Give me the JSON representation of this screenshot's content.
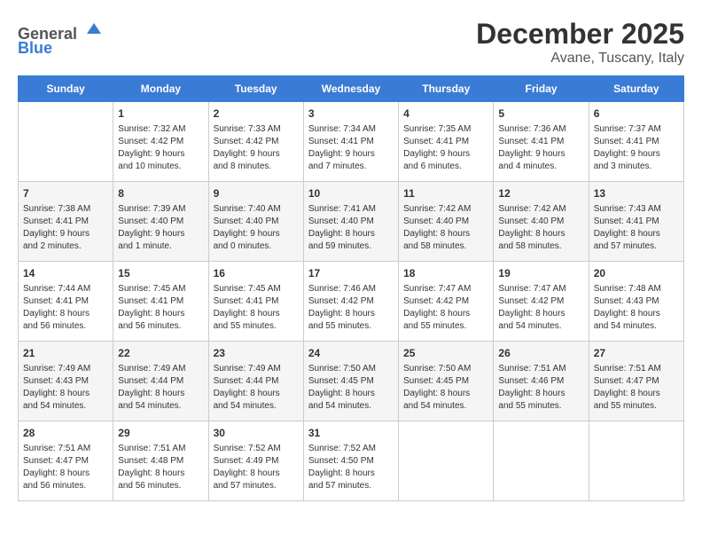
{
  "header": {
    "logo_line1": "General",
    "logo_line2": "Blue",
    "month": "December 2025",
    "location": "Avane, Tuscany, Italy"
  },
  "days_of_week": [
    "Sunday",
    "Monday",
    "Tuesday",
    "Wednesday",
    "Thursday",
    "Friday",
    "Saturday"
  ],
  "weeks": [
    [
      {
        "day": "",
        "content": ""
      },
      {
        "day": "1",
        "content": "Sunrise: 7:32 AM\nSunset: 4:42 PM\nDaylight: 9 hours\nand 10 minutes."
      },
      {
        "day": "2",
        "content": "Sunrise: 7:33 AM\nSunset: 4:42 PM\nDaylight: 9 hours\nand 8 minutes."
      },
      {
        "day": "3",
        "content": "Sunrise: 7:34 AM\nSunset: 4:41 PM\nDaylight: 9 hours\nand 7 minutes."
      },
      {
        "day": "4",
        "content": "Sunrise: 7:35 AM\nSunset: 4:41 PM\nDaylight: 9 hours\nand 6 minutes."
      },
      {
        "day": "5",
        "content": "Sunrise: 7:36 AM\nSunset: 4:41 PM\nDaylight: 9 hours\nand 4 minutes."
      },
      {
        "day": "6",
        "content": "Sunrise: 7:37 AM\nSunset: 4:41 PM\nDaylight: 9 hours\nand 3 minutes."
      }
    ],
    [
      {
        "day": "7",
        "content": "Sunrise: 7:38 AM\nSunset: 4:41 PM\nDaylight: 9 hours\nand 2 minutes."
      },
      {
        "day": "8",
        "content": "Sunrise: 7:39 AM\nSunset: 4:40 PM\nDaylight: 9 hours\nand 1 minute."
      },
      {
        "day": "9",
        "content": "Sunrise: 7:40 AM\nSunset: 4:40 PM\nDaylight: 9 hours\nand 0 minutes."
      },
      {
        "day": "10",
        "content": "Sunrise: 7:41 AM\nSunset: 4:40 PM\nDaylight: 8 hours\nand 59 minutes."
      },
      {
        "day": "11",
        "content": "Sunrise: 7:42 AM\nSunset: 4:40 PM\nDaylight: 8 hours\nand 58 minutes."
      },
      {
        "day": "12",
        "content": "Sunrise: 7:42 AM\nSunset: 4:40 PM\nDaylight: 8 hours\nand 58 minutes."
      },
      {
        "day": "13",
        "content": "Sunrise: 7:43 AM\nSunset: 4:41 PM\nDaylight: 8 hours\nand 57 minutes."
      }
    ],
    [
      {
        "day": "14",
        "content": "Sunrise: 7:44 AM\nSunset: 4:41 PM\nDaylight: 8 hours\nand 56 minutes."
      },
      {
        "day": "15",
        "content": "Sunrise: 7:45 AM\nSunset: 4:41 PM\nDaylight: 8 hours\nand 56 minutes."
      },
      {
        "day": "16",
        "content": "Sunrise: 7:45 AM\nSunset: 4:41 PM\nDaylight: 8 hours\nand 55 minutes."
      },
      {
        "day": "17",
        "content": "Sunrise: 7:46 AM\nSunset: 4:42 PM\nDaylight: 8 hours\nand 55 minutes."
      },
      {
        "day": "18",
        "content": "Sunrise: 7:47 AM\nSunset: 4:42 PM\nDaylight: 8 hours\nand 55 minutes."
      },
      {
        "day": "19",
        "content": "Sunrise: 7:47 AM\nSunset: 4:42 PM\nDaylight: 8 hours\nand 54 minutes."
      },
      {
        "day": "20",
        "content": "Sunrise: 7:48 AM\nSunset: 4:43 PM\nDaylight: 8 hours\nand 54 minutes."
      }
    ],
    [
      {
        "day": "21",
        "content": "Sunrise: 7:49 AM\nSunset: 4:43 PM\nDaylight: 8 hours\nand 54 minutes."
      },
      {
        "day": "22",
        "content": "Sunrise: 7:49 AM\nSunset: 4:44 PM\nDaylight: 8 hours\nand 54 minutes."
      },
      {
        "day": "23",
        "content": "Sunrise: 7:49 AM\nSunset: 4:44 PM\nDaylight: 8 hours\nand 54 minutes."
      },
      {
        "day": "24",
        "content": "Sunrise: 7:50 AM\nSunset: 4:45 PM\nDaylight: 8 hours\nand 54 minutes."
      },
      {
        "day": "25",
        "content": "Sunrise: 7:50 AM\nSunset: 4:45 PM\nDaylight: 8 hours\nand 54 minutes."
      },
      {
        "day": "26",
        "content": "Sunrise: 7:51 AM\nSunset: 4:46 PM\nDaylight: 8 hours\nand 55 minutes."
      },
      {
        "day": "27",
        "content": "Sunrise: 7:51 AM\nSunset: 4:47 PM\nDaylight: 8 hours\nand 55 minutes."
      }
    ],
    [
      {
        "day": "28",
        "content": "Sunrise: 7:51 AM\nSunset: 4:47 PM\nDaylight: 8 hours\nand 56 minutes."
      },
      {
        "day": "29",
        "content": "Sunrise: 7:51 AM\nSunset: 4:48 PM\nDaylight: 8 hours\nand 56 minutes."
      },
      {
        "day": "30",
        "content": "Sunrise: 7:52 AM\nSunset: 4:49 PM\nDaylight: 8 hours\nand 57 minutes."
      },
      {
        "day": "31",
        "content": "Sunrise: 7:52 AM\nSunset: 4:50 PM\nDaylight: 8 hours\nand 57 minutes."
      },
      {
        "day": "",
        "content": ""
      },
      {
        "day": "",
        "content": ""
      },
      {
        "day": "",
        "content": ""
      }
    ]
  ]
}
